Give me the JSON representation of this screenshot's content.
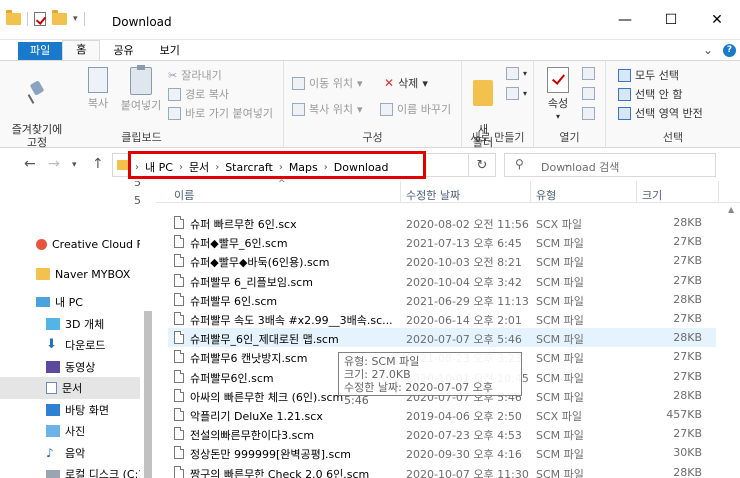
{
  "window": {
    "title": "Download",
    "min": "—",
    "max": "☐",
    "close": "✕"
  },
  "tabs": {
    "file": "파일",
    "home": "홈",
    "share": "공유",
    "view": "보기",
    "collapse": "⌄",
    "help": "?"
  },
  "ribbon": {
    "clipboard": {
      "pin": "즐겨찾기에\n고정",
      "copy": "복사",
      "paste": "붙여넣기",
      "cut": "잘라내기",
      "copy_path": "경로 복사",
      "paste_shortcut": "바로 가기 붙여넣기",
      "label": "클립보드"
    },
    "organize": {
      "move_to": "이동 위치",
      "copy_to": "복사 위치",
      "delete": "삭제",
      "rename": "이름 바꾸기",
      "label": "구성"
    },
    "new": {
      "new_folder": "새\n폴더",
      "label": "새로 만들기"
    },
    "open": {
      "properties": "속성",
      "label": "열기"
    },
    "select": {
      "select_all": "모두 선택",
      "select_none": "선택 안 함",
      "invert": "선택 영역 반전",
      "label": "선택"
    }
  },
  "address": {
    "crumbs": [
      "내 PC",
      "문서",
      "Starcraft",
      "Maps",
      "Download"
    ],
    "search_placeholder": "Download 검색",
    "highlight_color": "#e00000"
  },
  "nav_pane": {
    "items": [
      {
        "label": "Creative Cloud Fil",
        "icon": "creative-cloud-icon"
      },
      {
        "label": "Naver MYBOX",
        "icon": "mybox-icon"
      },
      {
        "label": "내 PC",
        "icon": "pc-icon"
      },
      {
        "label": "3D 개체",
        "icon": "3d-objects-icon"
      },
      {
        "label": "다운로드",
        "icon": "downloads-icon"
      },
      {
        "label": "동영상",
        "icon": "videos-icon"
      },
      {
        "label": "문서",
        "icon": "documents-icon",
        "selected": true
      },
      {
        "label": "바탕 화면",
        "icon": "desktop-icon"
      },
      {
        "label": "사진",
        "icon": "pictures-icon"
      },
      {
        "label": "음악",
        "icon": "music-icon"
      },
      {
        "label": "로컬 디스크 (C:)",
        "icon": "drive-icon"
      }
    ]
  },
  "columns": {
    "name": "이름",
    "date": "수정한 날짜",
    "type": "유형",
    "size": "크기"
  },
  "files": [
    {
      "name": "슈퍼 빠르무한 6인.scx",
      "date": "2020-08-02 오전 11:56",
      "type": "SCX 파일",
      "size": "28KB"
    },
    {
      "name": "슈퍼◆빨무_6인.scm",
      "date": "2021-07-13 오후 6:45",
      "type": "SCM 파일",
      "size": "27KB"
    },
    {
      "name": "슈퍼◆빨무◆바둑(6인용).scm",
      "date": "2020-10-03 오전 8:21",
      "type": "SCM 파일",
      "size": "27KB"
    },
    {
      "name": "슈퍼빨무 6_리플보임.scm",
      "date": "2020-10-04 오후 3:42",
      "type": "SCM 파일",
      "size": "27KB"
    },
    {
      "name": "슈퍼빨무 6인.scm",
      "date": "2021-06-29 오후 11:13",
      "type": "SCM 파일",
      "size": "28KB"
    },
    {
      "name": "슈퍼빨무 속도 3배속 #x2.99__3배속.sc...",
      "date": "2020-06-14 오후 2:01",
      "type": "SCM 파일",
      "size": "27KB"
    },
    {
      "name": "슈퍼빨무_6인_제대로된 맵.scm",
      "date": "2020-07-07 오후 5:46",
      "type": "SCM 파일",
      "size": "28KB",
      "hover": true
    },
    {
      "name": "슈퍼빨무6 캔낫방지.scm",
      "date": "2021-08-23 오후 3:23",
      "type": "SCM 파일",
      "size": "27KB"
    },
    {
      "name": "슈퍼빨무6인.scm",
      "date": "2020-10-01 오전 10:45",
      "type": "SCM 파일",
      "size": "27KB"
    },
    {
      "name": "아싸의 빠른무한 체크 (6인).scm",
      "date": "2020-07-07 오후 5:46",
      "type": "SCM 파일",
      "size": "28KB"
    },
    {
      "name": "악플리기 DeluXe 1.21.scx",
      "date": "2019-04-06 오후 2:50",
      "type": "SCX 파일",
      "size": "457KB"
    },
    {
      "name": "전설의빠른무한이다3.scm",
      "date": "2020-07-23 오후 4:53",
      "type": "SCM 파일",
      "size": "27KB"
    },
    {
      "name": "정상돈만 999999[완벽공평].scm",
      "date": "2020-09-30 오후 4:16",
      "type": "SCM 파일",
      "size": "30KB"
    },
    {
      "name": "짱구의 빠른무한 Check 2.0 6인.scm",
      "date": "2020-10-07 오후 11:30",
      "type": "SCM 파일",
      "size": "28KB"
    }
  ],
  "tooltip": {
    "type_line": "유형: SCM 파일",
    "size_line": "크기: 27.0KB",
    "date_line": "수정한 날짜: 2020-07-07 오후 5:46"
  }
}
